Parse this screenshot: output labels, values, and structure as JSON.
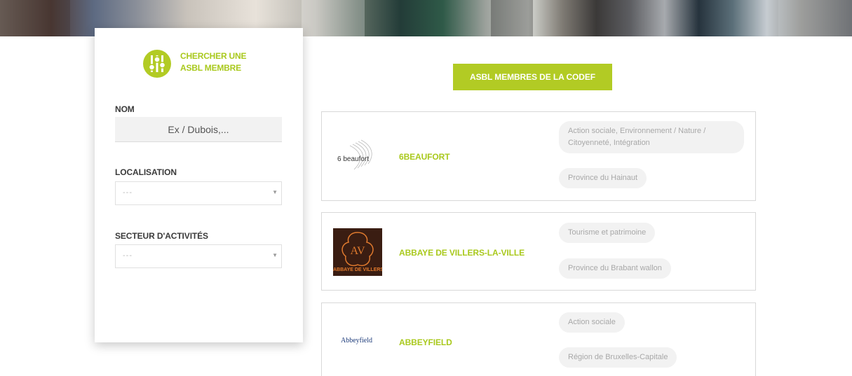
{
  "search": {
    "title_line1": "CHERCHER UNE",
    "title_line2": "ASBL MEMBRE",
    "name_label": "NOM",
    "name_placeholder": "Ex / Dubois,...",
    "location_label": "LOCALISATION",
    "location_value": "---",
    "sector_label": "SECTEUR D'ACTIVITÉS",
    "sector_value": "---"
  },
  "main": {
    "members_button": "ASBL MEMBRES DE LA CODEF",
    "results": [
      {
        "logo_text": "6 beaufort",
        "name": "6BEAUFORT",
        "sector": "Action sociale, Environnement / Nature / Citoyenneté, Intégration",
        "region": "Province du Hainaut"
      },
      {
        "logo_text": "ABBAYE DE VILLERS",
        "logo_mark": "AV",
        "name": "ABBAYE DE VILLERS-LA-VILLE",
        "sector": "Tourisme et patrimoine",
        "region": "Province du Brabant wallon"
      },
      {
        "logo_text": "Abbeyfield",
        "name": "ABBEYFIELD",
        "sector": "Action sociale",
        "region": "Région de Bruxelles-Capitale"
      }
    ]
  },
  "colors": {
    "accent": "#b2cb24",
    "accent_text": "#a9c91d",
    "tag_bg": "#f2f2f2",
    "av_logo_bg": "#3a1d12",
    "av_logo_line": "#e07a2e"
  },
  "icons": {
    "search_logo": "sliders-icon",
    "select_caret": "chevron-down-icon"
  }
}
